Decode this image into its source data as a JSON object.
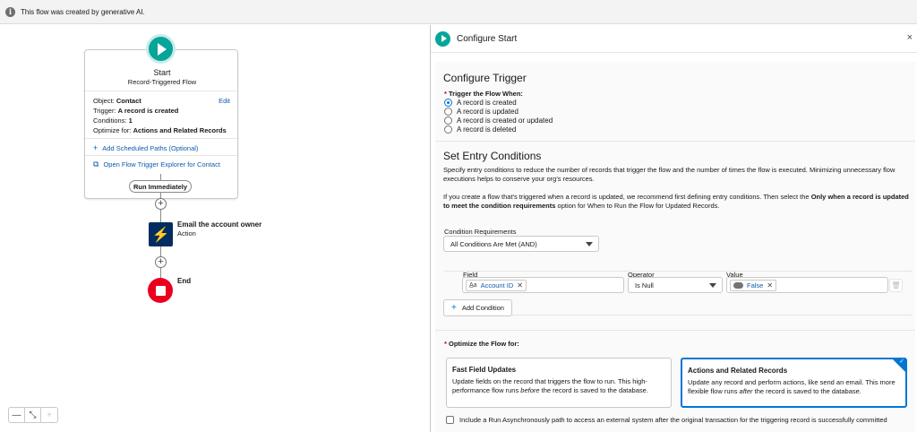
{
  "banner": {
    "text": "This flow was created by generative AI.",
    "icon": "info-icon"
  },
  "canvas": {
    "start": {
      "title": "Start",
      "subtitle": "Record-Triggered Flow",
      "edit": "Edit",
      "object_label": "Object:",
      "object_value": "Contact",
      "trigger_label": "Trigger:",
      "trigger_value": "A record is created",
      "conditions_label": "Conditions:",
      "conditions_value": "1",
      "optimize_label": "Optimize for:",
      "optimize_value": "Actions and Related Records",
      "add_paths": "Add Scheduled Paths (Optional)",
      "explorer": "Open Flow Trigger Explorer for Contact"
    },
    "run_immediately": "Run Immediately",
    "action": {
      "name": "Email the account owner",
      "type": "Action"
    },
    "end": "End"
  },
  "panel": {
    "title": "Configure Start",
    "close": "×",
    "trigger": {
      "title": "Configure Trigger",
      "label": "Trigger the Flow When:",
      "options": [
        "A record is created",
        "A record is updated",
        "A record is created or updated",
        "A record is deleted"
      ],
      "selected": 0
    },
    "entry": {
      "title": "Set Entry Conditions",
      "desc1": "Specify entry conditions to reduce the number of records that trigger the flow and the number of times the flow is executed. Minimizing unnecessary flow executions helps to conserve your org's resources.",
      "desc2a": "If you create a flow that's triggered when a record is updated, we recommend first defining entry conditions. Then select the ",
      "desc2b": "Only when a record is updated to meet the condition requirements",
      "desc2c": " option for When to Run the Flow for Updated Records.",
      "cond_req_label": "Condition Requirements",
      "cond_req_value": "All Conditions Are Met (AND)",
      "field_label": "Field",
      "field_value": "Account ID",
      "operator_label": "Operator",
      "operator_value": "Is Null",
      "value_label": "Value",
      "value_value": "False",
      "add_condition": "Add Condition"
    },
    "optimize": {
      "label": "Optimize the Flow for:",
      "fast_title": "Fast Field Updates",
      "fast_desc_a": "Update fields on the record that triggers the flow to run. This high-performance flow runs ",
      "fast_desc_em": "before",
      "fast_desc_b": " the record is saved to the database.",
      "actions_title": "Actions and Related Records",
      "actions_desc_a": "Update any record and perform actions, like send an email. This more flexible flow runs ",
      "actions_desc_em": "after",
      "actions_desc_b": " the record is saved to the database.",
      "async": "Include a Run Asynchronously path to access an external system after the original transaction for the triggering record is successfully committed"
    }
  }
}
